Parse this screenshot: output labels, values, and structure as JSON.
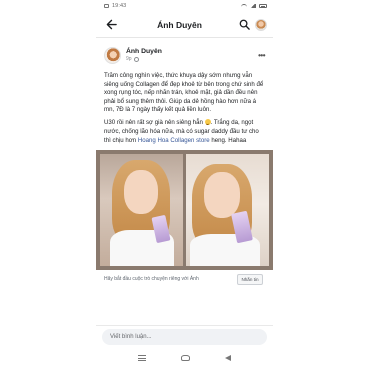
{
  "status_bar": {
    "time": "19:43"
  },
  "header": {
    "title": "Ánh Duyên",
    "back_icon": "back-arrow-icon",
    "search_icon": "search-icon"
  },
  "post": {
    "author": "Ánh Duyên",
    "time": "9p",
    "paragraph_1": "Trăm công nghìn việc, thức khuya dậy sớm nhưng vẫn siêng uống Collagen để đẹp khoẻ từ bên trong chứ sinh để xong rụng tóc, nếp nhăn trán, khoẻ mặt, giả dần đều nên phải bổ sung thêm thôi. Giúp da dẻ hồng hào hơn nữa á mn, 7Đ là 7 ngày thấy kết quả liền luôn.",
    "paragraph_2_before_emoji": "U30 rồi nên rất sợ già nên siêng hẳn ",
    "paragraph_2_after_emoji": ". Trắng da, ngọt nước, chống lão hóa nữa, mà có sugar daddy đầu tư cho thì chịu hơn ",
    "page_link": "Hoang Hoa Collagen store",
    "paragraph_2_end": " heng. Hahaa",
    "cta_text": "Hãy bắt đầu cuộc trò chuyện riêng với Ánh",
    "cta_button": "Nhắn tin"
  },
  "comment_bar": {
    "placeholder": "Viết bình luận..."
  }
}
